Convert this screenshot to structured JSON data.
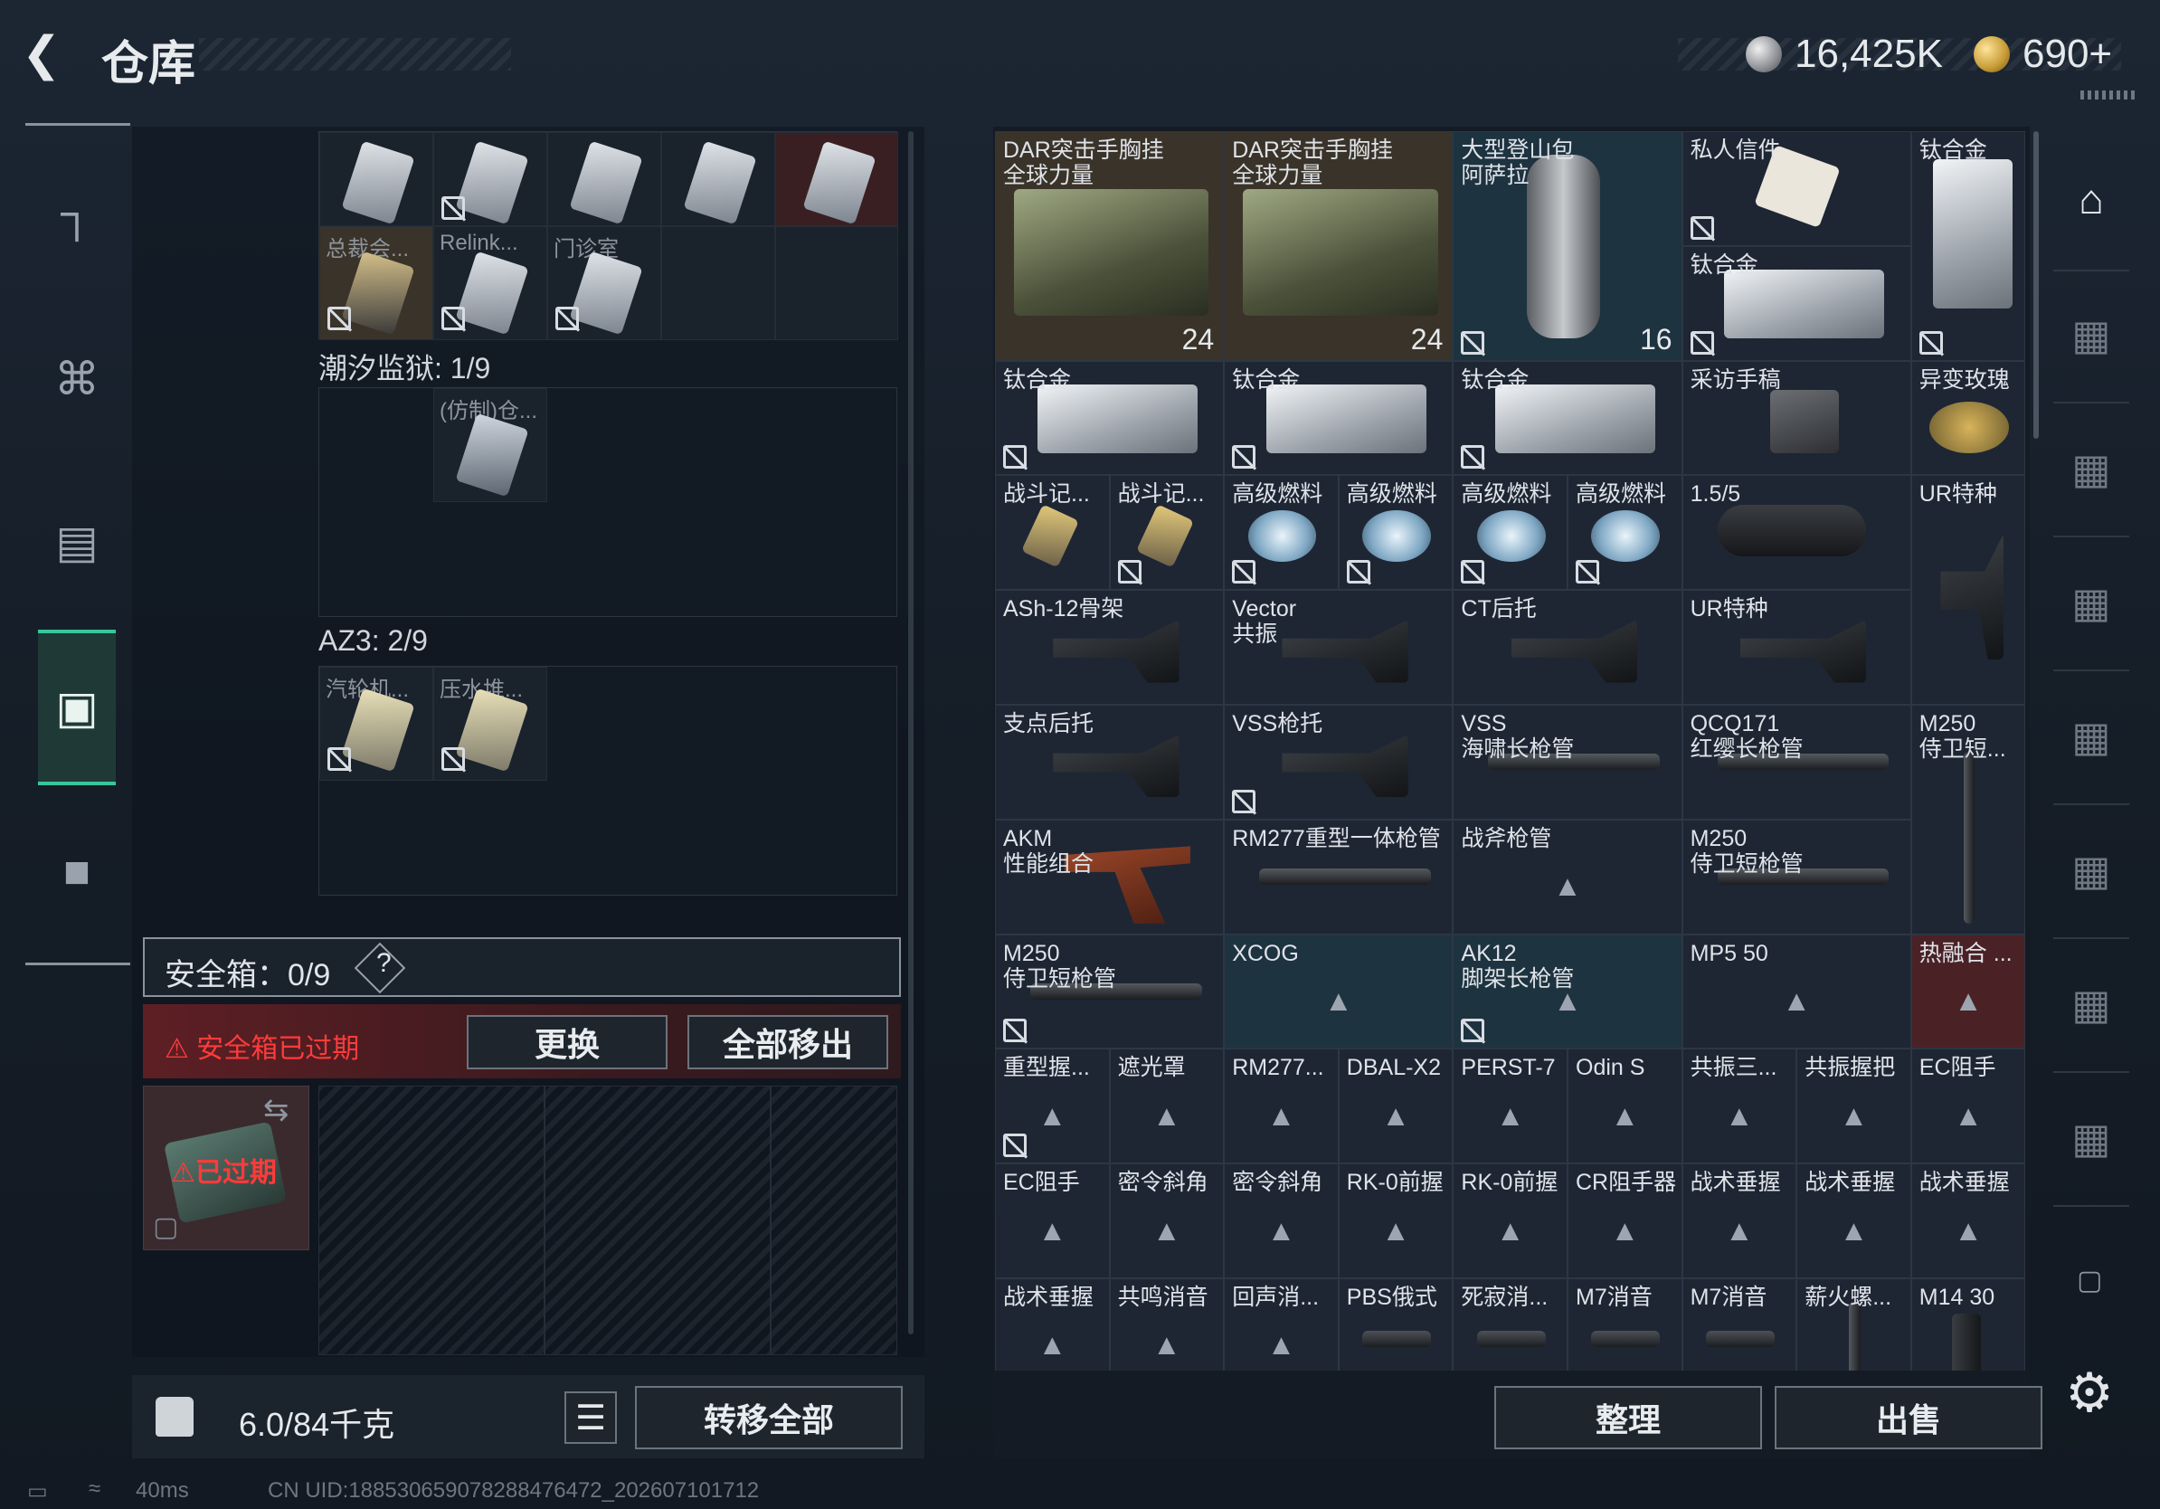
{
  "header": {
    "title": "仓库",
    "silver": "16,425K",
    "gold": "690+"
  },
  "left": {
    "sections": [
      {
        "label": "潮汐监狱: 1/9"
      },
      {
        "label": "AZ3: 2/9"
      }
    ],
    "top_items": [
      "总裁会...",
      "Relink...",
      "门诊室"
    ],
    "tide_items": [
      "(仿制)仓..."
    ],
    "az3_items": [
      "汽轮机...",
      "压水堆..."
    ],
    "safe": {
      "label": "安全箱：0/9",
      "help": "?",
      "expired_msg": "安全箱已过期",
      "replace_btn": "更换",
      "remove_all_btn": "全部移出",
      "case_expired": "已过期"
    },
    "weight": "6.0/84千克",
    "transfer_btn": "转移全部"
  },
  "right_grid": [
    {
      "label": "DAR突击手胸挂\n全球力量",
      "count": "24",
      "bg": "brown"
    },
    {
      "label": "DAR突击手胸挂\n全球力量",
      "count": "24",
      "bg": "brown"
    },
    {
      "label": "大型登山包\n阿萨拉",
      "count": "16",
      "bg": "teal"
    },
    {
      "label": "私人信件",
      "bg": "dark"
    },
    {
      "label": "钛合金",
      "bg": "dark"
    },
    {
      "label": "钛合金",
      "bg": "dark"
    },
    {
      "label": "钛合金"
    },
    {
      "label": "钛合金"
    },
    {
      "label": "钛合金"
    },
    {
      "label": "采访手稿"
    },
    {
      "label": "异变玫瑰"
    },
    {
      "label": "战斗记..."
    },
    {
      "label": "战斗记..."
    },
    {
      "label": "高级燃料"
    },
    {
      "label": "高级燃料"
    },
    {
      "label": "高级燃料"
    },
    {
      "label": "高级燃料"
    },
    {
      "label": "1.5/5"
    },
    {
      "label": "UR特种"
    },
    {
      "label": "ASh-12骨架"
    },
    {
      "label": "Vector\n共振"
    },
    {
      "label": "CT后托"
    },
    {
      "label": "UR特种"
    },
    {
      "label": "支点后托"
    },
    {
      "label": "VSS枪托"
    },
    {
      "label": "VSS\n海啸长枪管"
    },
    {
      "label": "QCQ171\n红缨长枪管"
    },
    {
      "label": "M250\n侍卫短..."
    },
    {
      "label": "AKM\n性能组合"
    },
    {
      "label": "RM277重型一体枪管"
    },
    {
      "label": "战斧枪管"
    },
    {
      "label": "M250\n侍卫短枪管"
    },
    {
      "label": "M250\n侍卫短枪管"
    },
    {
      "label": "XCOG"
    },
    {
      "label": "AK12\n脚架长枪管"
    },
    {
      "label": "MP5 50"
    },
    {
      "label": "热融合 ..."
    },
    {
      "label": "重型握..."
    },
    {
      "label": "遮光罩"
    },
    {
      "label": "RM277..."
    },
    {
      "label": "DBAL-X2"
    },
    {
      "label": "PERST-7"
    },
    {
      "label": "Odin S"
    },
    {
      "label": "共振三..."
    },
    {
      "label": "共振握把"
    },
    {
      "label": "EC阻手"
    },
    {
      "label": "EC阻手"
    },
    {
      "label": "密令斜角"
    },
    {
      "label": "密令斜角"
    },
    {
      "label": "RK-0前握"
    },
    {
      "label": "RK-0前握"
    },
    {
      "label": "CR阻手器"
    },
    {
      "label": "战术垂握"
    },
    {
      "label": "战术垂握"
    },
    {
      "label": "战术垂握"
    },
    {
      "label": "战术垂握"
    },
    {
      "label": "共鸣消音"
    },
    {
      "label": "回声消..."
    },
    {
      "label": "PBS俄式"
    },
    {
      "label": "死寂消..."
    },
    {
      "label": "M7消音"
    },
    {
      "label": "M7消音"
    },
    {
      "label": "薪火螺..."
    },
    {
      "label": "M14 30"
    }
  ],
  "buttons": {
    "sort": "整理",
    "sell": "出售"
  },
  "status": {
    "ping": "40ms",
    "uid": "CN UID:18853065907828847​6472_202607101712"
  },
  "colors": {
    "accent": "#37c79a",
    "warn": "#ff3b3b"
  }
}
